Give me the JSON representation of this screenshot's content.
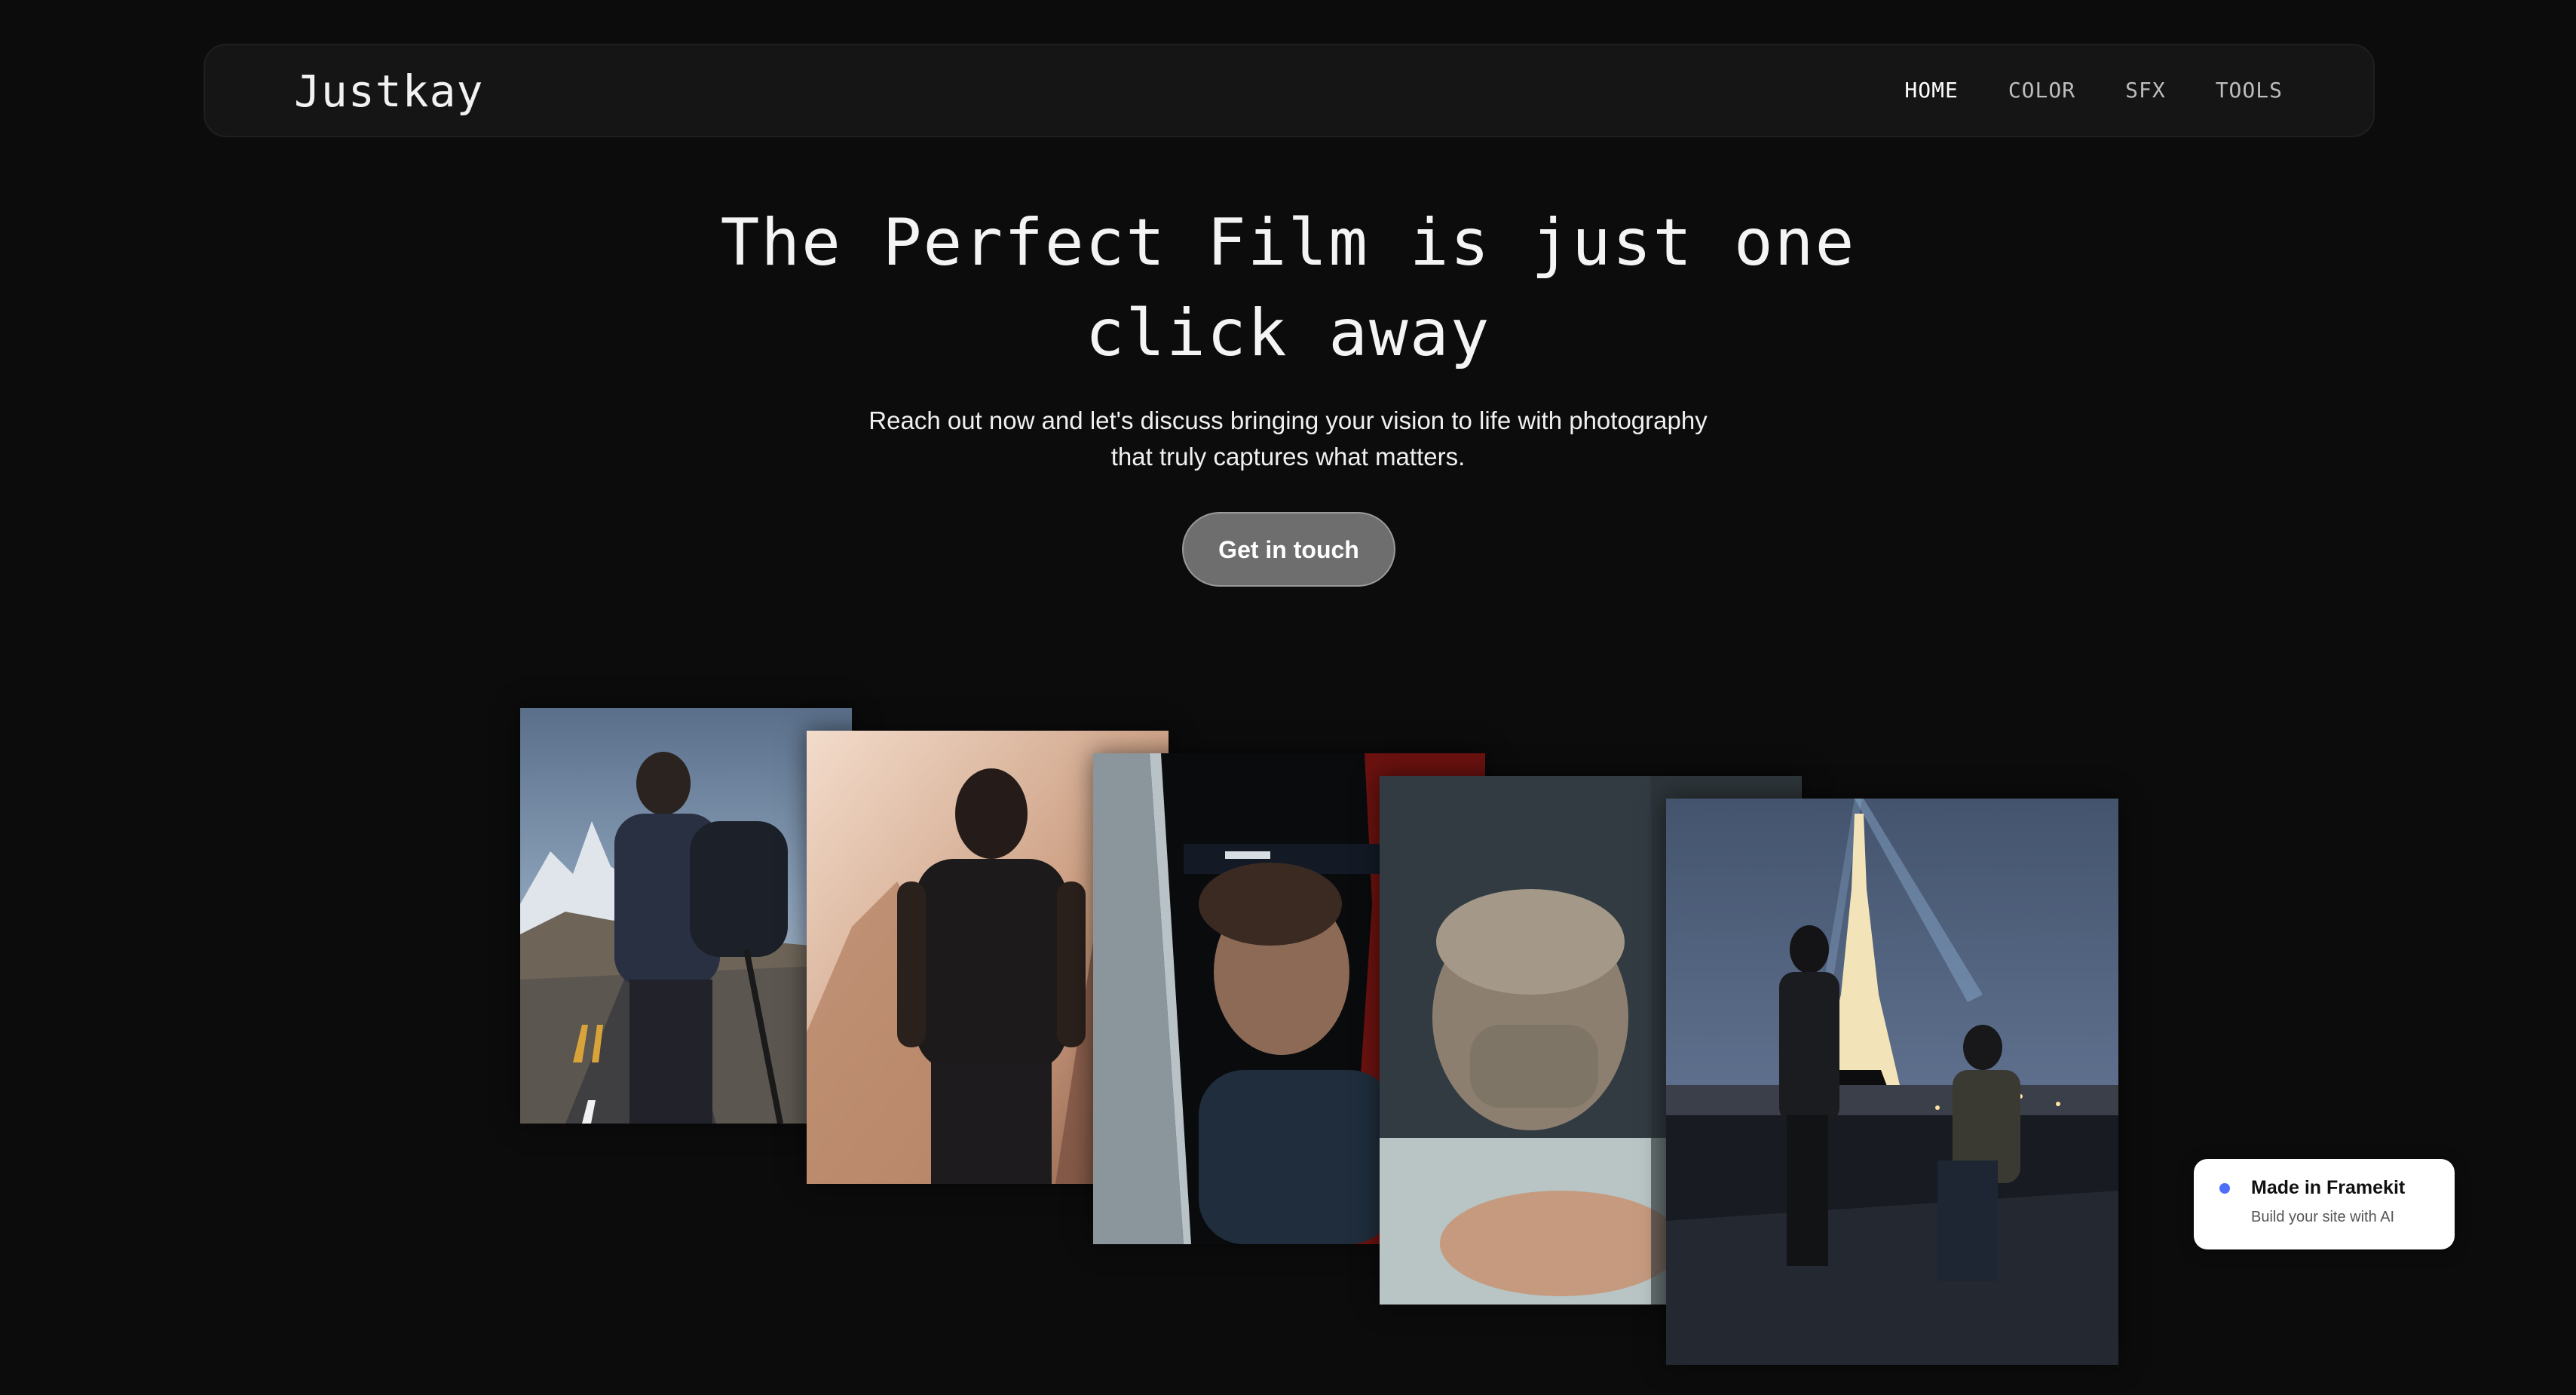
{
  "header": {
    "logo": "Justkay",
    "nav": [
      {
        "label": "HOME",
        "active": true
      },
      {
        "label": "COLOR",
        "active": false
      },
      {
        "label": "SFX",
        "active": false
      },
      {
        "label": "TOOLS",
        "active": false
      }
    ]
  },
  "hero": {
    "title_line1": "The Perfect Film is just one",
    "title_line2": "click away",
    "subtitle_line1": "Reach out now and let's discuss bringing your vision to life with photography",
    "subtitle_line2": "that truly captures what matters.",
    "cta_label": "Get in touch"
  },
  "gallery": [
    {
      "subject": "hiker-with-backpack-on-mountain-road"
    },
    {
      "subject": "man-silhouette-in-hazy-mountains"
    },
    {
      "subject": "young-man-in-car-doorway"
    },
    {
      "subject": "man-with-face-scarf"
    },
    {
      "subject": "two-men-on-rooftop-eiffel-tower-night"
    }
  ],
  "badge": {
    "title": "Made in Framekit",
    "subtitle": "Build your site with AI",
    "dot_color": "#4f6ef7"
  },
  "colors": {
    "background": "#0c0c0c",
    "navbar": "#151515",
    "cta": "#6e6e6e"
  }
}
